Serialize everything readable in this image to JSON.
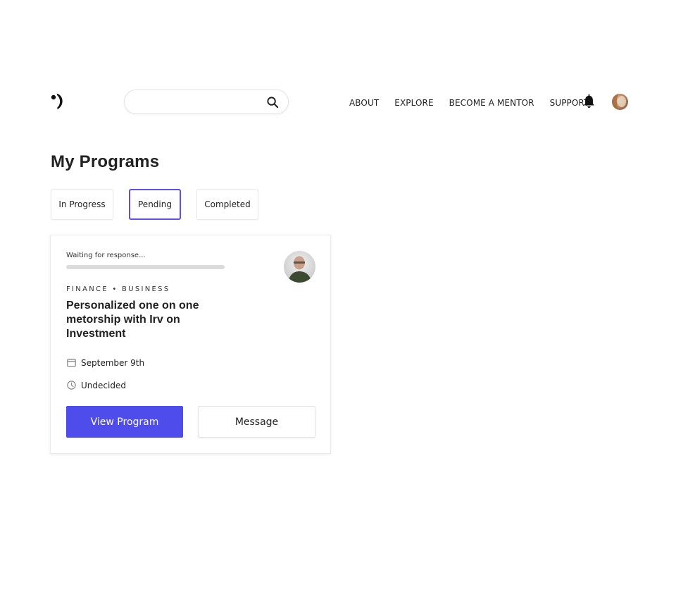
{
  "header": {
    "logo_icon": "brand-logo-icon",
    "search": {
      "placeholder": "",
      "value": "",
      "icon": "search-icon"
    },
    "nav": [
      {
        "label": "ABOUT"
      },
      {
        "label": "EXPLORE"
      },
      {
        "label": "BECOME A MENTOR"
      },
      {
        "label": "SUPPORT"
      }
    ],
    "notification_icon": "bell-icon",
    "user_avatar": "user-avatar"
  },
  "page": {
    "title": "My Programs",
    "tabs": [
      {
        "label": "In Progress",
        "active": false
      },
      {
        "label": "Pending",
        "active": true
      },
      {
        "label": "Completed",
        "active": false
      }
    ]
  },
  "program_card": {
    "status": "Waiting for response...",
    "progress": 0,
    "category": "FINANCE • BUSINESS",
    "title": "Personalized one on one metorship with Irv on Investment",
    "date": {
      "icon": "calendar-icon",
      "label": "September 9th"
    },
    "time": {
      "icon": "clock-icon",
      "label": "Undecided"
    },
    "primary_button": "View Program",
    "secondary_button": "Message"
  },
  "colors": {
    "accent": "#4f4cec",
    "tab_active_border": "#5a52e8",
    "progress_track": "#dcdcdc"
  }
}
